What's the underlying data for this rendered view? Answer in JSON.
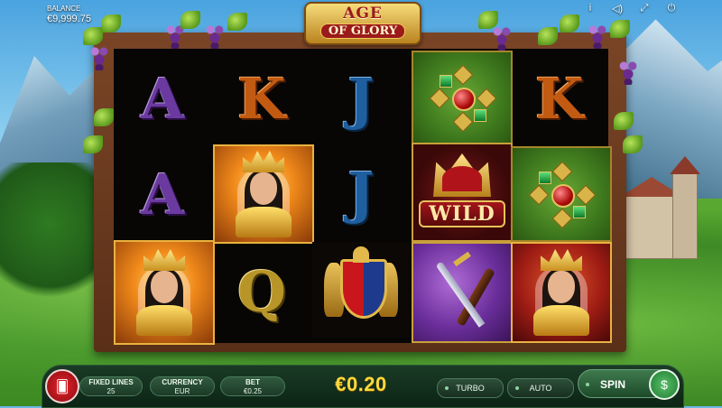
{
  "header": {
    "balance_label": "BALANCE",
    "balance_value": "€9,999.75",
    "logo_top": "AGE",
    "logo_bottom": "OF GLORY",
    "icons": [
      "info-icon",
      "sound-icon",
      "fullscreen-icon",
      "power-icon"
    ],
    "icon_glyphs": [
      "i",
      "◁)",
      "⤢",
      "⏻"
    ]
  },
  "reels": [
    [
      "A",
      "A",
      "queen"
    ],
    [
      "K",
      "queen",
      "Q"
    ],
    [
      "J",
      "J",
      "shield"
    ],
    [
      "gem",
      "wild",
      "sword"
    ],
    [
      "K",
      "gem",
      "queen"
    ]
  ],
  "wild_label": "WILD",
  "controls": {
    "fixed_lines_label": "FIXED LINES",
    "fixed_lines_value": "25",
    "currency_label": "CURRENCY",
    "currency_value": "EUR",
    "bet_label": "BET",
    "bet_value": "€0.25",
    "total_bet": "€0.20",
    "turbo_label": "TURBO",
    "auto_label": "AUTO",
    "spin_label": "SPIN"
  },
  "colors": {
    "total_bet": "#ffd93a",
    "menu_button": "#e8242c",
    "bar_bg": "#1a3b26"
  }
}
